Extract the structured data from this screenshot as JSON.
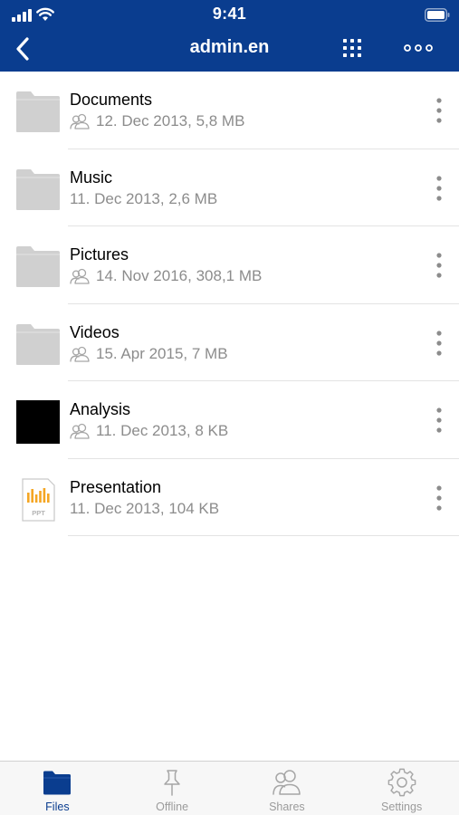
{
  "status_bar": {
    "time": "9:41"
  },
  "nav": {
    "title": "admin.en"
  },
  "files": [
    {
      "name": "Documents",
      "meta": "12. Dec 2013, 5,8 MB",
      "shared": true,
      "type": "folder"
    },
    {
      "name": "Music",
      "meta": "11. Dec 2013, 2,6 MB",
      "shared": false,
      "type": "folder"
    },
    {
      "name": "Pictures",
      "meta": "14. Nov 2016, 308,1 MB",
      "shared": true,
      "type": "folder"
    },
    {
      "name": "Videos",
      "meta": "15. Apr 2015, 7 MB",
      "shared": true,
      "type": "folder"
    },
    {
      "name": "Analysis",
      "meta": "11. Dec 2013, 8 KB",
      "shared": true,
      "type": "image"
    },
    {
      "name": "Presentation",
      "meta": "11. Dec 2013, 104 KB",
      "shared": false,
      "type": "ppt",
      "badge": "PPT"
    }
  ],
  "tabs": [
    {
      "label": "Files",
      "icon": "folder-icon",
      "active": true
    },
    {
      "label": "Offline",
      "icon": "pin-icon",
      "active": false
    },
    {
      "label": "Shares",
      "icon": "users-icon",
      "active": false
    },
    {
      "label": "Settings",
      "icon": "gear-icon",
      "active": false
    }
  ],
  "colors": {
    "brand": "#0a3d8f",
    "folder": "#d0d0d0",
    "ppt_accent": "#f5a623",
    "meta_text": "#8c8c8c"
  }
}
